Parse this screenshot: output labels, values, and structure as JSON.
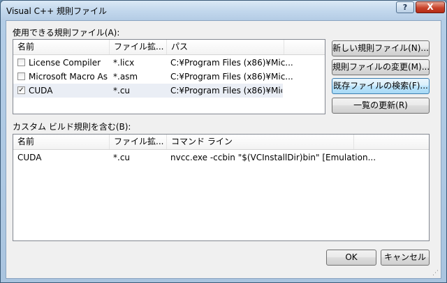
{
  "window": {
    "title": "Visual C++ 規則ファイル",
    "help_label": "?",
    "close_label": "X"
  },
  "rule_files": {
    "label": "使用できる規則ファイル(A):",
    "columns": [
      "名前",
      "ファイル拡...",
      "パス"
    ],
    "rows": [
      {
        "name": "License Compiler",
        "ext": "*.licx",
        "path": "C:¥Program Files (x86)¥Mic...",
        "checked": false,
        "check_mark": ""
      },
      {
        "name": "Microsoft Macro As...",
        "ext": "*.asm",
        "path": "C:¥Program Files (x86)¥Mic...",
        "checked": false,
        "check_mark": ""
      },
      {
        "name": "CUDA",
        "ext": "*.cu",
        "path": "C:¥Program Files (x86)¥Mic...",
        "checked": true,
        "check_mark": "✓"
      }
    ]
  },
  "buttons": {
    "new_rule": "新しい規則ファイル(N)...",
    "modify_rule": "規則ファイルの変更(M)...",
    "find_existing": "既存ファイルの検索(F)...",
    "refresh": "一覧の更新(R)",
    "ok": "OK",
    "cancel": "キャンセル"
  },
  "custom_rules": {
    "label": "カスタム ビルド規則を含む(B):",
    "columns": [
      "名前",
      "ファイル拡...",
      "コマンド ライン"
    ],
    "rows": [
      {
        "name": "CUDA",
        "ext": "*.cu",
        "command": "nvcc.exe -ccbin \"$(VCInstallDir)bin\" [Emulation..."
      }
    ]
  }
}
